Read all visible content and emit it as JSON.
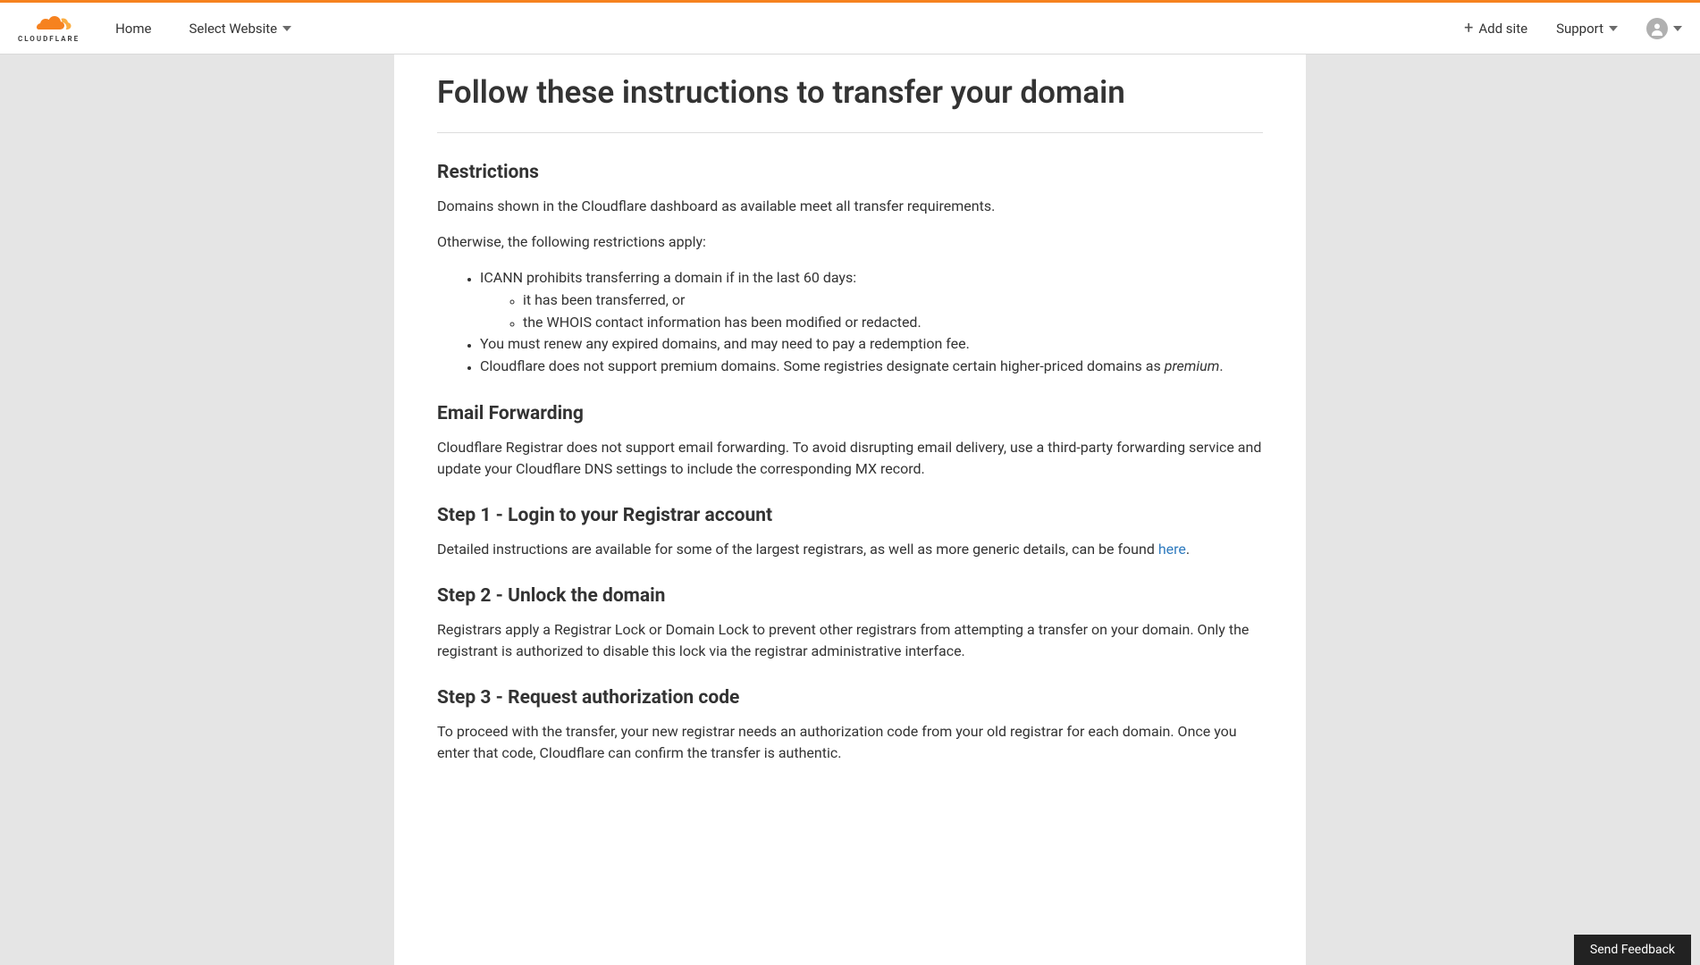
{
  "brand": "CLOUDFLARE",
  "nav": {
    "home": "Home",
    "select_website": "Select Website",
    "add_site": "Add site",
    "support": "Support"
  },
  "page": {
    "title": "Follow these instructions to transfer your domain",
    "sections": {
      "restrictions": {
        "heading": "Restrictions",
        "p1": "Domains shown in the Cloudflare dashboard as available meet all transfer requirements.",
        "p2": "Otherwise, the following restrictions apply:",
        "li1": "ICANN prohibits transferring a domain if in the last 60 days:",
        "li1a": "it has been transferred, or",
        "li1b": "the WHOIS contact information has been modified or redacted.",
        "li2": "You must renew any expired domains, and may need to pay a redemption fee.",
        "li3_pre": "Cloudflare does not support premium domains. Some registries designate certain higher-priced domains as ",
        "li3_em": "premium",
        "li3_post": "."
      },
      "email_forwarding": {
        "heading": "Email Forwarding",
        "p1": "Cloudflare Registrar does not support email forwarding. To avoid disrupting email delivery, use a third-party forwarding service and update your Cloudflare DNS settings to include the corresponding MX record."
      },
      "step1": {
        "heading": "Step 1 - Login to your Registrar account",
        "p1_pre": "Detailed instructions are available for some of the largest registrars, as well as more generic details, can be found ",
        "p1_link": "here",
        "p1_post": "."
      },
      "step2": {
        "heading": "Step 2 - Unlock the domain",
        "p1": "Registrars apply a Registrar Lock or Domain Lock to prevent other registrars from attempting a transfer on your domain. Only the registrant is authorized to disable this lock via the registrar administrative interface."
      },
      "step3": {
        "heading": "Step 3 - Request authorization code",
        "p1": "To proceed with the transfer, your new registrar needs an authorization code from your old registrar for each domain. Once you enter that code, Cloudflare can confirm the transfer is authentic."
      }
    }
  },
  "feedback": "Send Feedback"
}
